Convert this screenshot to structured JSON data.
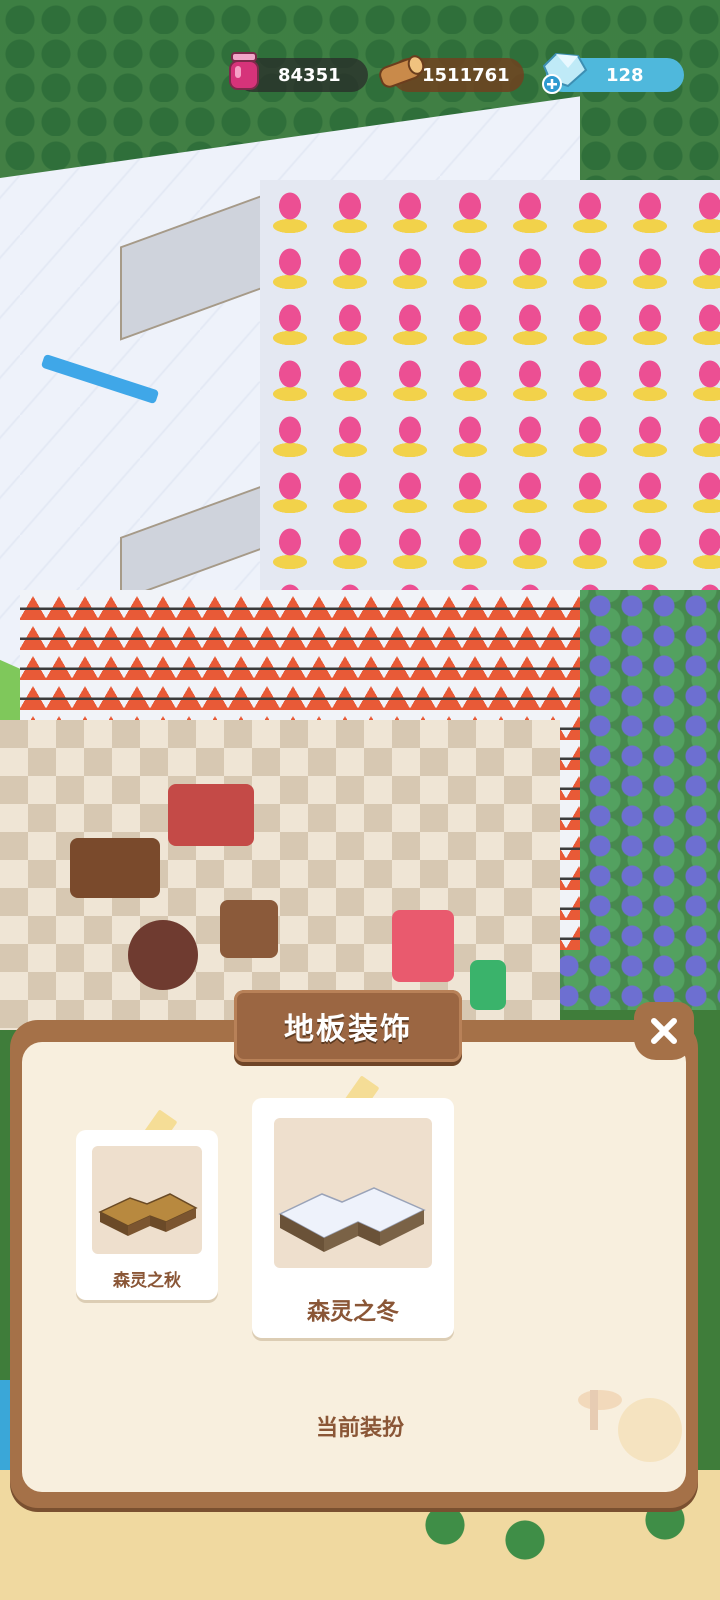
{
  "hud": {
    "jam_count": "84351",
    "wood_count": "1511761",
    "gem_count": "128"
  },
  "panel": {
    "title": "地板装饰",
    "floor_options": [
      {
        "label": "森灵之秋",
        "selected": false
      },
      {
        "label": "森灵之冬",
        "selected": true
      }
    ],
    "current_status": "当前装扮"
  },
  "icons": {
    "jam": "jam-jar-icon",
    "wood": "wood-log-icon",
    "gem": "gem-add-icon",
    "close": "close-icon"
  },
  "colors": {
    "panel_frame": "#a57148",
    "panel_fill": "#f8efde",
    "label_text": "#8a5636",
    "gem_pill": "#4fb8dc"
  }
}
